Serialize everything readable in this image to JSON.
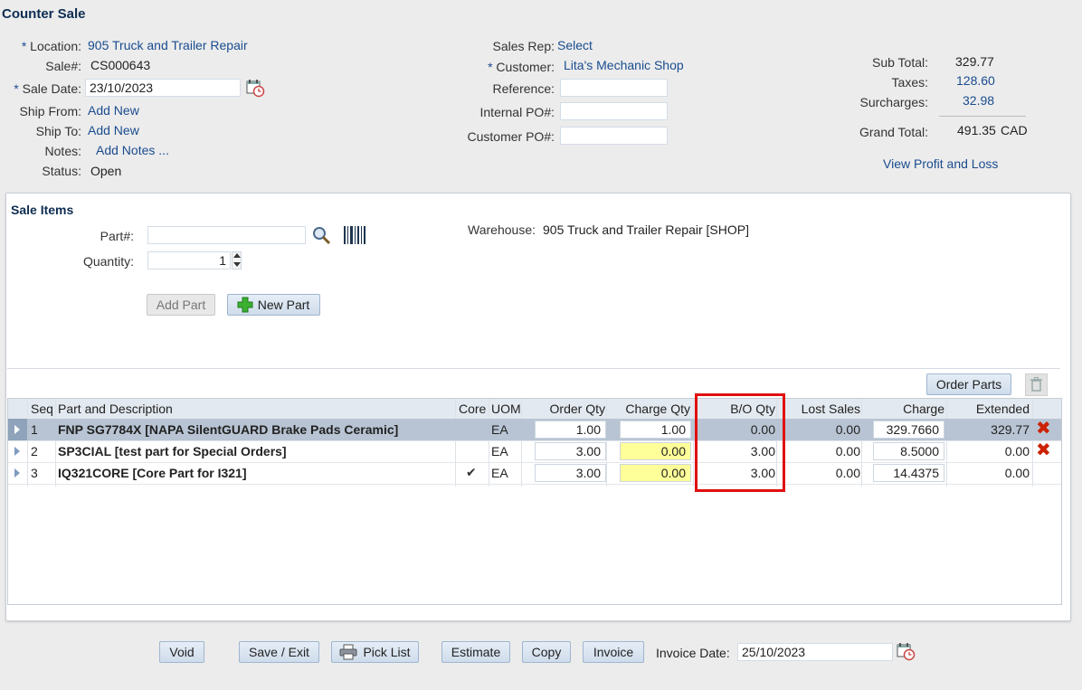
{
  "page_title": "Counter Sale",
  "header": {
    "location_label": "Location:",
    "location_value": "905 Truck and Trailer Repair",
    "sale_label": "Sale#:",
    "sale_value": "CS000643",
    "sale_date_label": "Sale Date:",
    "sale_date_value": "23/10/2023",
    "ship_from_label": "Ship From:",
    "ship_from_value": "Add New",
    "ship_to_label": "Ship To:",
    "ship_to_value": "Add New",
    "notes_label": "Notes:",
    "notes_value": "Add Notes ...",
    "status_label": "Status:",
    "status_value": "Open",
    "sales_rep_label": "Sales Rep:",
    "sales_rep_value": "Select",
    "customer_label": "Customer:",
    "customer_value": "Lita's Mechanic Shop",
    "reference_label": "Reference:",
    "internal_po_label": "Internal PO#:",
    "customer_po_label": "Customer PO#:",
    "required_mark": "*"
  },
  "totals": {
    "subtotal_label": "Sub Total:",
    "subtotal_value": "329.77",
    "taxes_label": "Taxes:",
    "taxes_value": "128.60",
    "surcharges_label": "Surcharges:",
    "surcharges_value": "32.98",
    "grand_total_label": "Grand Total:",
    "grand_total_value": "491.35",
    "currency": "CAD",
    "profit_loss_link": "View Profit and Loss"
  },
  "sale_items": {
    "title": "Sale Items",
    "part_label": "Part#:",
    "quantity_label": "Quantity:",
    "quantity_value": "1",
    "warehouse_label": "Warehouse:",
    "warehouse_value": "905 Truck and Trailer Repair [SHOP]",
    "add_part_button": "Add Part",
    "new_part_button": "New Part",
    "order_parts_button": "Order Parts"
  },
  "grid": {
    "columns": [
      "Seq",
      "Part and Description",
      "Core",
      "UOM",
      "Order Qty",
      "Charge Qty",
      "B/O Qty",
      "Lost Sales",
      "Charge",
      "Extended"
    ],
    "rows": [
      {
        "seq": "1",
        "part": "FNP SG7784X [NAPA SilentGUARD Brake Pads Ceramic]",
        "core": "",
        "uom": "EA",
        "order_qty": "1.00",
        "charge_qty": "1.00",
        "bo_qty": "0.00",
        "lost_sales": "0.00",
        "charge": "329.7660",
        "extended": "329.77"
      },
      {
        "seq": "2",
        "part": "SP3CIAL [test part for Special Orders]",
        "core": "",
        "uom": "EA",
        "order_qty": "3.00",
        "charge_qty": "0.00",
        "bo_qty": "3.00",
        "lost_sales": "0.00",
        "charge": "8.5000",
        "extended": "0.00"
      },
      {
        "seq": "3",
        "part": "IQ321CORE [Core Part for I321]",
        "core": "✔",
        "uom": "EA",
        "order_qty": "3.00",
        "charge_qty": "0.00",
        "bo_qty": "3.00",
        "lost_sales": "0.00",
        "charge": "14.4375",
        "extended": "0.00"
      }
    ]
  },
  "footer": {
    "void_button": "Void",
    "save_exit_button": "Save / Exit",
    "pick_list_button": "Pick List",
    "estimate_button": "Estimate",
    "copy_button": "Copy",
    "invoice_button": "Invoice",
    "invoice_date_label": "Invoice Date:",
    "invoice_date_value": "25/10/2023"
  },
  "colors": {
    "highlight_box": "#e01010",
    "link": "#1a4c8f",
    "selected_row": "#b8c4d3"
  }
}
